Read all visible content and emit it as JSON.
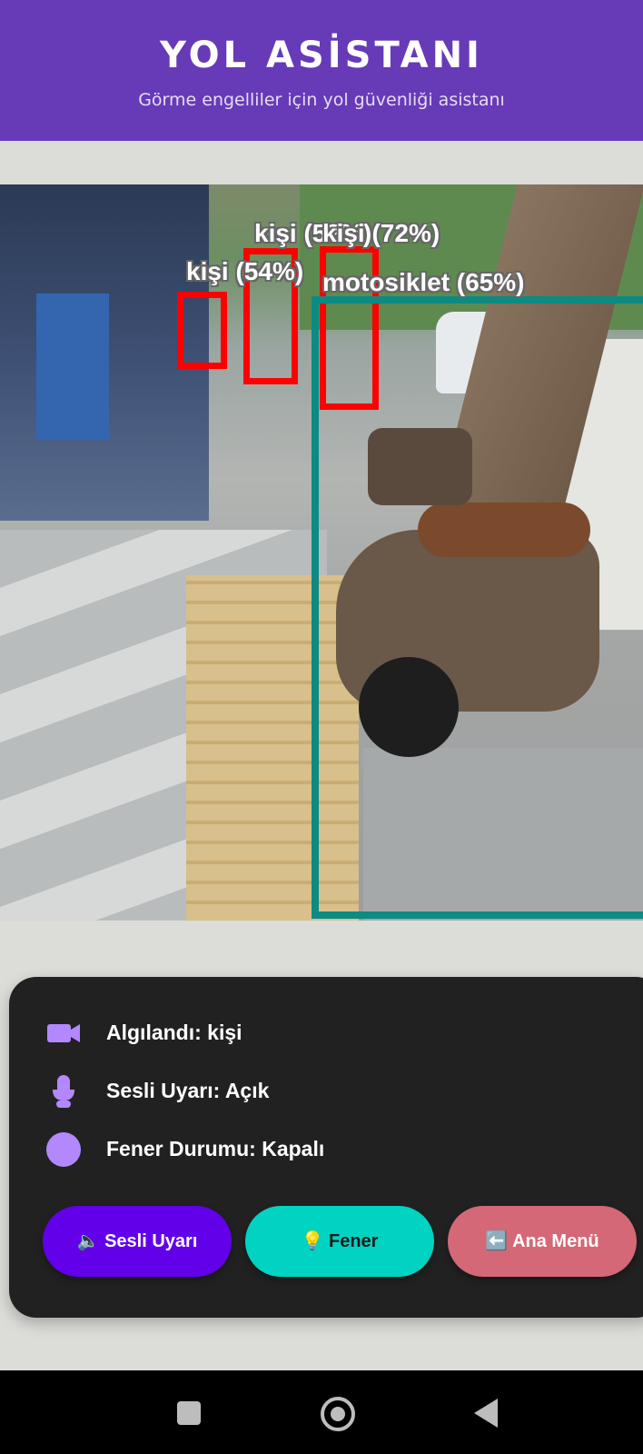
{
  "header": {
    "title": "YOL ASİSTANI",
    "subtitle": "Görme engelliler için yol güvenliği asistanı",
    "background_color": "#673ab7"
  },
  "camera": {
    "detections": [
      {
        "label": "kişi (54%)",
        "color": "#ff0000"
      },
      {
        "label": "kişi (52%)",
        "color": "#ff0000"
      },
      {
        "label": "kişi (72%)",
        "color": "#ff0000"
      },
      {
        "label": "motosiklet (65%)",
        "color": "#0d8a82"
      }
    ]
  },
  "status": {
    "detected": "Algılandı: kişi",
    "detected_icon": "video-camera-icon",
    "voice": "Sesli Uyarı: Açık",
    "voice_icon": "microphone-icon",
    "torch": "Fener Durumu: Kapalı",
    "torch_icon": "circle-indicator-icon",
    "icon_color": "#b388ff"
  },
  "buttons": {
    "voice": {
      "label": "🔈 Sesli Uyarı",
      "color": "#6200ea"
    },
    "torch": {
      "label": "💡 Fener",
      "color": "#00d3c2"
    },
    "menu": {
      "label": "⬅️ Ana Menü",
      "color": "#d56876"
    }
  },
  "navbar": {
    "recent_icon": "square-icon",
    "home_icon": "home-circle-icon",
    "back_icon": "back-triangle-icon"
  }
}
